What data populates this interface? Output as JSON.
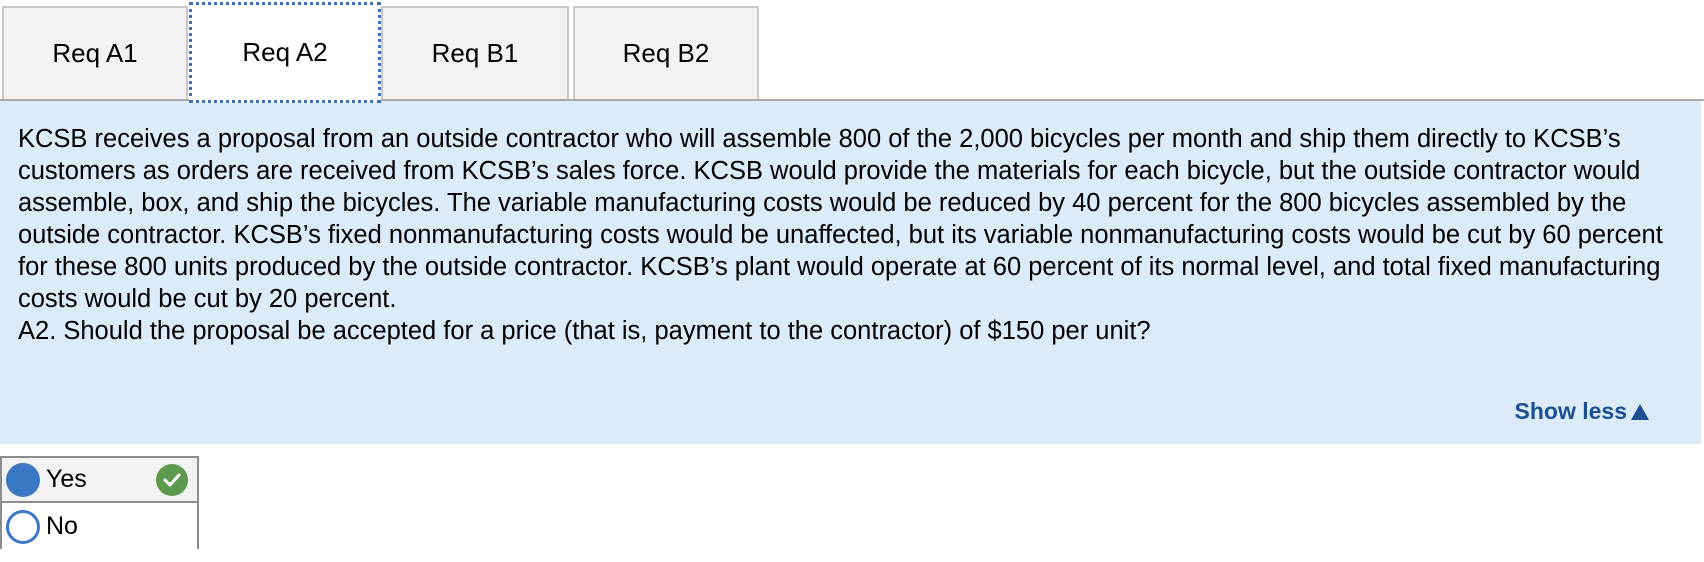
{
  "tabs": [
    {
      "label": "Req A1",
      "active": false
    },
    {
      "label": "Req A2",
      "active": true
    },
    {
      "label": "Req B1",
      "active": false
    },
    {
      "label": "Req B2",
      "active": false
    }
  ],
  "question": {
    "paragraph": "KCSB receives a proposal from an outside contractor who will assemble 800 of the 2,000 bicycles per month and ship them directly to KCSB’s customers as orders are received from KCSB’s sales force. KCSB would provide the materials for each bicycle, but the outside contractor would assemble, box, and ship the bicycles. The variable manufacturing costs would be reduced by 40 percent for the 800 bicycles assembled by the outside contractor. KCSB’s fixed nonmanufacturing costs would be unaffected, but its variable nonmanufacturing costs would be cut by 60 percent for these 800 units produced by the outside contractor. KCSB’s plant would operate at 60 percent of its normal level, and total fixed manufacturing costs would be cut by 20 percent.",
    "prompt": "A2. Should the proposal be accepted for a price (that is, payment to the contractor) of $150 per unit?",
    "toggle_label": "Show less"
  },
  "answer": {
    "options": [
      {
        "label": "Yes",
        "selected": true,
        "correct": true
      },
      {
        "label": "No",
        "selected": false
      }
    ]
  },
  "colors": {
    "panel_background": "#dbebf7",
    "link": "#1d4f91",
    "radio": "#3b78c3",
    "correct": "#5d9a4f",
    "active_tab_border": "#3e72b8"
  }
}
